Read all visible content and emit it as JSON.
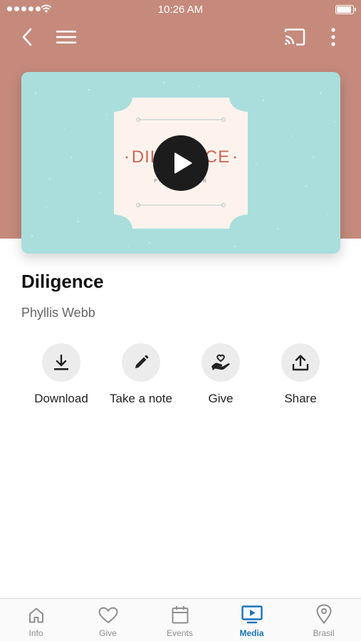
{
  "status_bar": {
    "time": "10:26 AM"
  },
  "nav": {
    "back": "back-icon",
    "menu": "hamburger-icon",
    "cast": "cast-icon",
    "more": "more-vertical-icon"
  },
  "media": {
    "artwork_title": "DILIGENCE",
    "artwork_subtitle": "PHYLLIS WEBB",
    "background_color": "#a9dedd",
    "header_color": "#c58a7c",
    "title_accent": "#c9675a"
  },
  "item": {
    "title": "Diligence",
    "author": "Phyllis Webb"
  },
  "actions": [
    {
      "label": "Download",
      "icon": "download-icon"
    },
    {
      "label": "Take a note",
      "icon": "pencil-icon"
    },
    {
      "label": "Give",
      "icon": "give-heart-hand-icon"
    },
    {
      "label": "Share",
      "icon": "share-icon"
    }
  ],
  "tabs": [
    {
      "label": "Info",
      "icon": "home-icon",
      "active": false
    },
    {
      "label": "Give",
      "icon": "heart-icon",
      "active": false
    },
    {
      "label": "Events",
      "icon": "calendar-icon",
      "active": false
    },
    {
      "label": "Media",
      "icon": "tv-play-icon",
      "active": true
    },
    {
      "label": "Brasil",
      "icon": "location-pin-icon",
      "active": false
    }
  ],
  "colors": {
    "active_tab": "#1b73b8",
    "inactive_tab": "#8e8e8e"
  }
}
